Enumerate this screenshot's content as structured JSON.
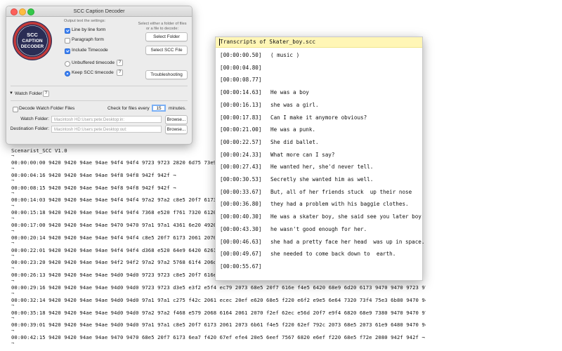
{
  "decoder": {
    "title": "SCC Caption Decoder",
    "logo": {
      "line1": "SCC",
      "line2": "CAPTION",
      "line3": "DECODER"
    },
    "output_heading": "Output text the settings:",
    "select_hint": "Select either a folder of files or a file to decode:",
    "options": {
      "line_by_line": {
        "label": "Line by line form",
        "checked": true
      },
      "paragraph": {
        "label": "Paragraph form",
        "checked": false
      },
      "include_timecode": {
        "label": "Include Timecode",
        "checked": true
      },
      "unbuffered_timecode": {
        "label": "Unbuffered timecode",
        "selected": false
      },
      "keep_scc_timecode": {
        "label": "Keep SCC timecode",
        "selected": true
      }
    },
    "buttons": {
      "select_folder": "Select Folder",
      "select_scc_file": "Select SCC File",
      "troubleshooting": "Troubleshooting",
      "browse1": "Browse...",
      "browse2": "Browse..."
    },
    "help_glyph": "?",
    "watch_folder": {
      "heading": "Watch Folder",
      "decode_label": "Decode Watch Folder Files",
      "check_label": "Check for files every",
      "check_value": "15",
      "minutes_label": "minutes.",
      "watch_label": "Watch Folder:",
      "watch_placeholder": "Macintosh HD:Users:pete:Desktop:in:",
      "dest_label": "Destination Folder:",
      "dest_placeholder": "Macintosh HD:Users:pete:Desktop:out:"
    }
  },
  "transcript": {
    "title": "Transcripts of Skater_boy.scc",
    "rows": [
      {
        "tc": "[00:00:00.50]",
        "text": "( music )"
      },
      {
        "tc": "[00:00:04.80]",
        "text": ""
      },
      {
        "tc": "[00:00:08.77]",
        "text": ""
      },
      {
        "tc": "[00:00:14.63]",
        "text": "He was a boy"
      },
      {
        "tc": "[00:00:16.13]",
        "text": "she was a girl."
      },
      {
        "tc": "[00:00:17.83]",
        "text": "Can I make it anymore obvious?"
      },
      {
        "tc": "[00:00:21.00]",
        "text": "He was a punk."
      },
      {
        "tc": "[00:00:22.57]",
        "text": "She did ballet."
      },
      {
        "tc": "[00:00:24.33]",
        "text": "What more can I say?"
      },
      {
        "tc": "[00:00:27.43]",
        "text": "He wanted her, she'd never tell."
      },
      {
        "tc": "[00:00:30.53]",
        "text": "Secretly she wanted him as well."
      },
      {
        "tc": "[00:00:33.67]",
        "text": "But, all of her friends stuck  up their nose"
      },
      {
        "tc": "[00:00:36.80]",
        "text": "they had a problem with his baggie clothes."
      },
      {
        "tc": "[00:00:40.30]",
        "text": "He was a skater boy, she said see you later boy"
      },
      {
        "tc": "[00:00:43.30]",
        "text": "he wasn't good enough for her."
      },
      {
        "tc": "[00:00:46.63]",
        "text": "she had a pretty face her head  was up in space."
      },
      {
        "tc": "[00:00:49.67]",
        "text": "she needed to come back down to  earth."
      },
      {
        "tc": "[00:00:55.67]",
        "text": ""
      }
    ]
  },
  "scc": {
    "header": "Scenarist_SCC V1.0",
    "separator": "¬",
    "lines": [
      "00:00:00:00 9420 9420 94ae 94ae 94f4 94f4 9723 9723 2820 6d75 73e9 e320 2",
      "00:00:04:16 9420 9420 94ae 94ae 94f8 94f8 942f 942f ¬",
      "00:00:08:15 9420 9420 94ae 94ae 94f8 94f8 942f 942f ¬",
      "00:00:14:03 9420 9420 94ae 94ae 94f4 94f4 97a2 97a2 c8e5 20f7 6173 2061 2",
      "00:00:15:18 9420 9420 94ae 94ae 94f4 94f4 7368 e520 f761 7320 6120 67e9 7",
      "00:00:17:00 9420 9420 94ae 94ae 9470 9470 97a1 97a1 4361 6e20 4920 6d61 6",
      "00:00:20:14 9420 9420 94ae 94ae 94f4 94f4 c8e5 20f7 6173 2061 2070 756e 6",
      "00:00:22:01 9420 9420 94ae 94ae 94f4 94f4 d368 e520 64e9 6420 6261 ecec 6",
      "00:00:23:20 9420 9420 94ae 94ae 94f2 94f2 97a2 97a2 5768 61f4 206d eff2 e",
      "00:00:26:13 9420 9420 94ae 94ae 94d0 94d0 9723 9723 c8e5 20f7 616e f4e5 6",
      "00:00:29:16 9420 9420 94ae 94ae 94d0 94d0 9723 9723 d3e5 e3f2 e5f4 ec79 2073 68e5 20f7 616e f4e5 6420 68e9 6d20 6173 9470 9470 9723 9723 f7c",
      "00:00:32:14 9420 9420 94ae 94ae 94d0 94d0 97a1 97a1 c275 f42c 2061 ecec 20ef e620 68e5 f220 e6f2 e9e5 6e64 7320 73f4 75e3 6b80 9470 9470 97",
      "00:00:35:18 9420 9420 94ae 94ae 94d0 94d0 97a2 97a2 f468 e579 2068 6164 2061 2070 f2ef 62ec e56d 20f7 e9f4 6820 68e9 7380 9470 9470 97a2 97c",
      "00:00:39:01 9420 9420 94ae 94ae 94d0 94d0 97a1 97a1 c8e5 20f7 6173 2061 2073 6b61 f4e5 f220 62ef 792c 2073 68e5 2073 61e9 6480 9470 9470 97c",
      "00:00:42:15 9420 9420 94ae 94ae 9470 9470 68e5 20f7 6173 6ea7 f420 67ef efe4 20e5 6eef 7567 6820 e6ef f220 68e5 f72e 2080 942f 942f ¬"
    ]
  }
}
